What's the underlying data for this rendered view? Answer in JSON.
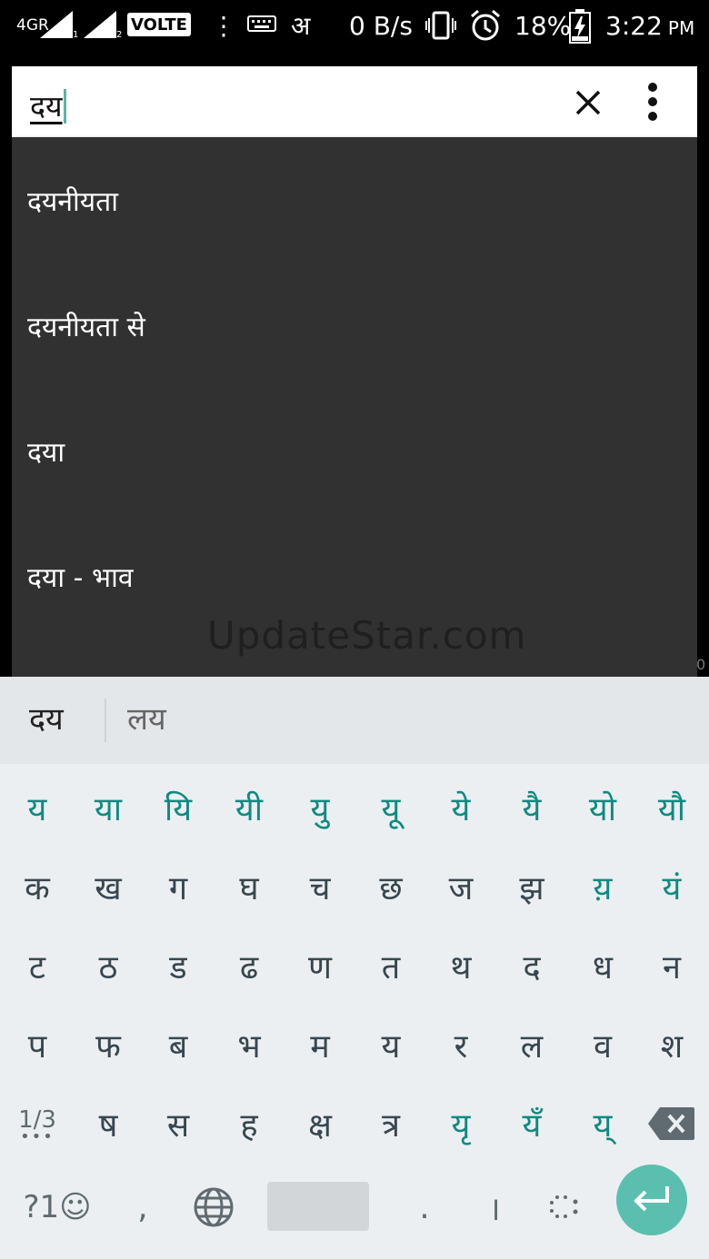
{
  "status_bar": {
    "network": "4GR",
    "sim1": "1",
    "sim2": "2",
    "volte": "VOLTE",
    "more": "⋮",
    "hindi_indicator": "अ",
    "data_speed": "0 B/s",
    "battery": "18%",
    "time": "3:22",
    "ampm": "PM"
  },
  "search": {
    "query": "दय"
  },
  "suggestions": [
    "दयनीयता",
    "दयनीयता से",
    "दया",
    "दया - भाव"
  ],
  "watermark": "UpdateStar.com",
  "edge_text": "0",
  "keyboard": {
    "candidates": [
      "दय",
      "लय"
    ],
    "row1": [
      "य",
      "या",
      "यि",
      "यी",
      "यु",
      "यू",
      "ये",
      "यै",
      "यो",
      "यौ"
    ],
    "row2": [
      "क",
      "ख",
      "ग",
      "घ",
      "च",
      "छ",
      "ज",
      "झ",
      "य़",
      "यं"
    ],
    "row3": [
      "ट",
      "ठ",
      "ड",
      "ढ",
      "ण",
      "त",
      "थ",
      "द",
      "ध",
      "न"
    ],
    "row4": [
      "प",
      "फ",
      "ब",
      "भ",
      "म",
      "य",
      "र",
      "ल",
      "व",
      "श"
    ],
    "row5": [
      "ष",
      "स",
      "ह",
      "क्ष",
      "त्र",
      "यृ",
      "यँ",
      "य्"
    ],
    "page_indicator": "1/3",
    "symbols_key": "?1☺",
    "comma": ",",
    "period": ".",
    "danda": "।",
    "teal_color": "#0f8a80",
    "enter_color": "#5bbfb0"
  }
}
